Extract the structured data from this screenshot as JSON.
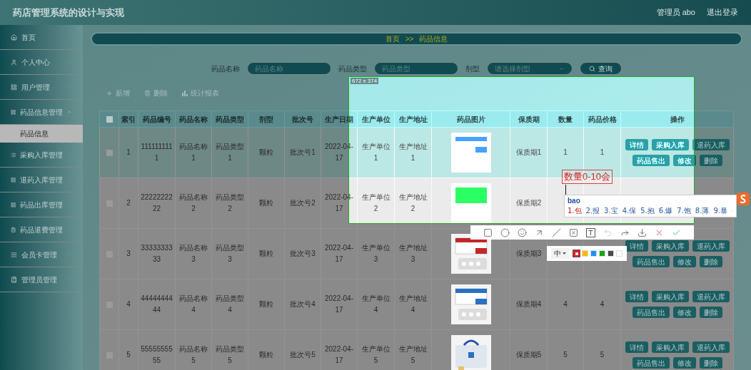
{
  "header": {
    "title": "药店管理系统的设计与实现",
    "user": "管理员 abo",
    "logout": "退出登录"
  },
  "sidebar": {
    "items": [
      {
        "label": "首页",
        "kind": "link",
        "selected": false
      },
      {
        "label": "个人中心",
        "kind": "menu",
        "expanded": false,
        "selected": false
      },
      {
        "label": "用户管理",
        "kind": "menu",
        "expanded": false,
        "selected": false
      },
      {
        "label": "药品信息管理",
        "kind": "menu",
        "expanded": true,
        "selected": false,
        "children": [
          {
            "label": "药品信息",
            "selected": true
          }
        ]
      },
      {
        "label": "采购入库管理",
        "kind": "menu",
        "expanded": false,
        "selected": false
      },
      {
        "label": "退药入库管理",
        "kind": "menu",
        "expanded": false,
        "selected": false
      },
      {
        "label": "药品出库管理",
        "kind": "menu",
        "expanded": false,
        "selected": false
      },
      {
        "label": "药品退费管理",
        "kind": "menu",
        "expanded": false,
        "selected": false
      },
      {
        "label": "会员卡管理",
        "kind": "menu",
        "expanded": false,
        "selected": false
      },
      {
        "label": "管理员管理",
        "kind": "menu",
        "expanded": false,
        "selected": false
      }
    ]
  },
  "breadcrumb": {
    "items": [
      "首页",
      "药品信息"
    ],
    "separator": ">>"
  },
  "search": {
    "fields": [
      {
        "kind": "input",
        "label": "药品名称",
        "placeholder": "药品名称"
      },
      {
        "kind": "input",
        "label": "药品类型",
        "placeholder": "药品类型"
      },
      {
        "kind": "select",
        "label": "剂型",
        "placeholder": "请选择剂型"
      }
    ],
    "button": "查询"
  },
  "actions": [
    "新增",
    "删除",
    "统计报表"
  ],
  "table": {
    "header_checked": false,
    "columns": [
      "索引",
      "药品编号",
      "药品名称",
      "药品类型",
      "剂型",
      "批次号",
      "生产日期",
      "生产单位",
      "生产地址",
      "药品图片",
      "保质期",
      "数量",
      "药品价格",
      "操作"
    ],
    "rows": [
      {
        "checked": false,
        "hovered": true,
        "index": "1",
        "code": "1111111111",
        "name": "药品名称1",
        "type": "药品类型1",
        "form": "颗粒",
        "batch": "批次号1",
        "date": "2022-04-17",
        "unit": "生产单位1",
        "address": "生产地址1",
        "image": {
          "kind": "picture"
        },
        "shelf_life": "保质期1",
        "quantity": "1",
        "price": "1",
        "buttons": [
          "详情",
          "采购入库",
          "退药入库",
          "药品售出",
          "修改",
          "删除"
        ]
      },
      {
        "checked": false,
        "hovered": false,
        "index": "2",
        "code": "2222222222",
        "name": "药品名称2",
        "type": "药品类型2",
        "form": "颗粒",
        "batch": "批次号2",
        "date": "2022-04-17",
        "unit": "生产单位2",
        "address": "生产地址2",
        "image": {
          "kind": "picture"
        },
        "shelf_life": "保质期2",
        "buttons": []
      },
      {
        "checked": false,
        "hovered": false,
        "index": "3",
        "code": "3333333333",
        "name": "药品名称3",
        "type": "药品类型3",
        "form": "颗粒",
        "batch": "批次号3",
        "date": "2022-04-17",
        "unit": "生产单位3",
        "address": "生产地址3",
        "image": {
          "kind": "picture"
        },
        "shelf_life": "保质期3",
        "buttons": [
          "详情",
          "采购入库",
          "退药入库",
          "药品售出",
          "修改",
          "删除"
        ]
      },
      {
        "checked": false,
        "hovered": false,
        "index": "4",
        "code": "4444444444",
        "name": "药品名称4",
        "type": "药品类型4",
        "form": "颗粒",
        "batch": "批次号4",
        "date": "2022-04-17",
        "unit": "生产单位4",
        "address": "生产地址4",
        "image": {
          "kind": "picture"
        },
        "shelf_life": "保质期4",
        "quantity": "4",
        "price": "4",
        "buttons": [
          "详情",
          "采购入库",
          "退药入库",
          "药品售出",
          "修改",
          "删除"
        ]
      },
      {
        "checked": false,
        "hovered": false,
        "index": "5",
        "code": "5555555555",
        "name": "药品名称5",
        "type": "药品类型5",
        "form": "颗粒",
        "batch": "批次号5",
        "date": "2022-04-17",
        "unit": "生产单位5",
        "address": "生产地址5",
        "image": {
          "kind": "picture"
        },
        "shelf_life": "保质期5",
        "quantity": "5",
        "price": "5",
        "buttons": [
          "详情",
          "采购入库",
          "退药入库",
          "药品售出",
          "修改",
          "删除"
        ]
      }
    ]
  },
  "capture": {
    "size": "672 x 374",
    "annotation": "数量0-10会",
    "ime": {
      "input": "bao",
      "candidates": [
        {
          "text": "1.包",
          "selected": true
        },
        {
          "text": "2.报",
          "selected": false
        },
        {
          "text": "3.宝",
          "selected": false
        },
        {
          "text": "4.保",
          "selected": false
        },
        {
          "text": "5.抱",
          "selected": false
        },
        {
          "text": "6.爆",
          "selected": false
        },
        {
          "text": "7.饱",
          "selected": false
        },
        {
          "text": "8.薄",
          "selected": false
        },
        {
          "text": "9.暴",
          "selected": false
        }
      ]
    },
    "tools": [
      {
        "kind": "rect",
        "disabled": false
      },
      {
        "kind": "ellipse",
        "disabled": false
      },
      {
        "kind": "emoji",
        "disabled": false
      },
      {
        "kind": "arrow",
        "disabled": false
      },
      {
        "kind": "line",
        "disabled": false
      },
      {
        "kind": "mosaic",
        "disabled": false
      },
      {
        "kind": "text",
        "disabled": false
      },
      {
        "kind": "undo",
        "disabled": true
      },
      {
        "kind": "share",
        "disabled": false
      },
      {
        "kind": "save",
        "disabled": false
      },
      {
        "kind": "cancel",
        "disabled": false
      },
      {
        "kind": "confirm",
        "disabled": false
      }
    ],
    "palette": {
      "size": "中",
      "colors": [
        {
          "color": "#e02020",
          "selected": true
        },
        {
          "color": "#ffb800",
          "selected": false
        },
        {
          "color": "#1e90ff",
          "selected": false
        },
        {
          "color": "#1aa51a",
          "selected": false
        },
        {
          "color": "#4a4a4a",
          "selected": false
        },
        {
          "color": "#ffffff",
          "selected": false
        }
      ]
    }
  }
}
